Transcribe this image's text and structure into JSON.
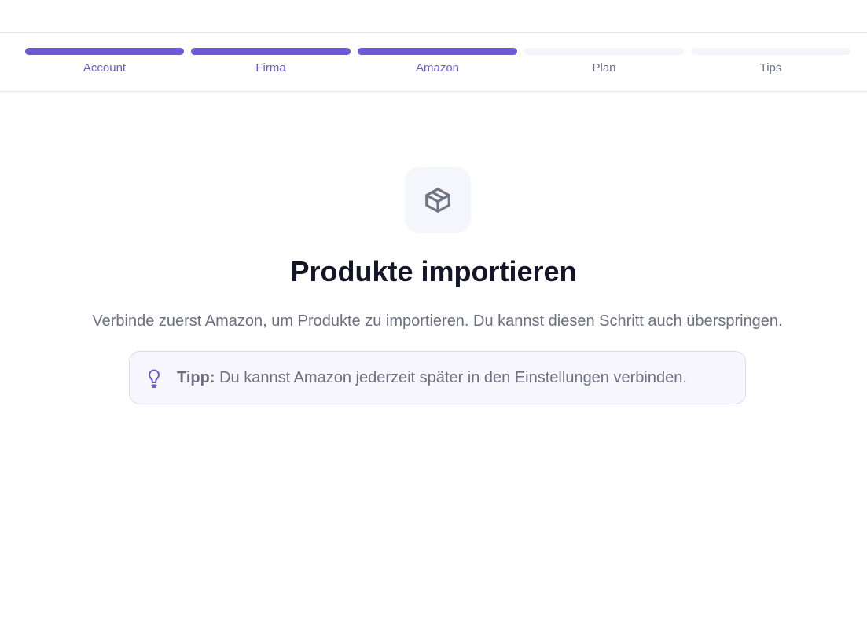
{
  "steps": [
    {
      "label": "Account",
      "state": "done"
    },
    {
      "label": "Firma",
      "state": "done"
    },
    {
      "label": "Amazon",
      "state": "done"
    },
    {
      "label": "Plan",
      "state": "todo"
    },
    {
      "label": "Tips",
      "state": "todo"
    }
  ],
  "main": {
    "icon": "package-icon",
    "title": "Produkte importieren",
    "subtitle": "Verbinde zuerst Amazon, um Produkte zu importieren. Du kannst diesen Schritt auch überspringen.",
    "tip": {
      "icon": "lightbulb-icon",
      "label": "Tipp:",
      "text": " Du kannst Amazon jederzeit später in den Einstellungen verbinden."
    }
  },
  "colors": {
    "accent": "#6d5bd6",
    "inactive_bar": "#f4f5fa",
    "title": "#141627",
    "muted_text": "#6b7080"
  }
}
